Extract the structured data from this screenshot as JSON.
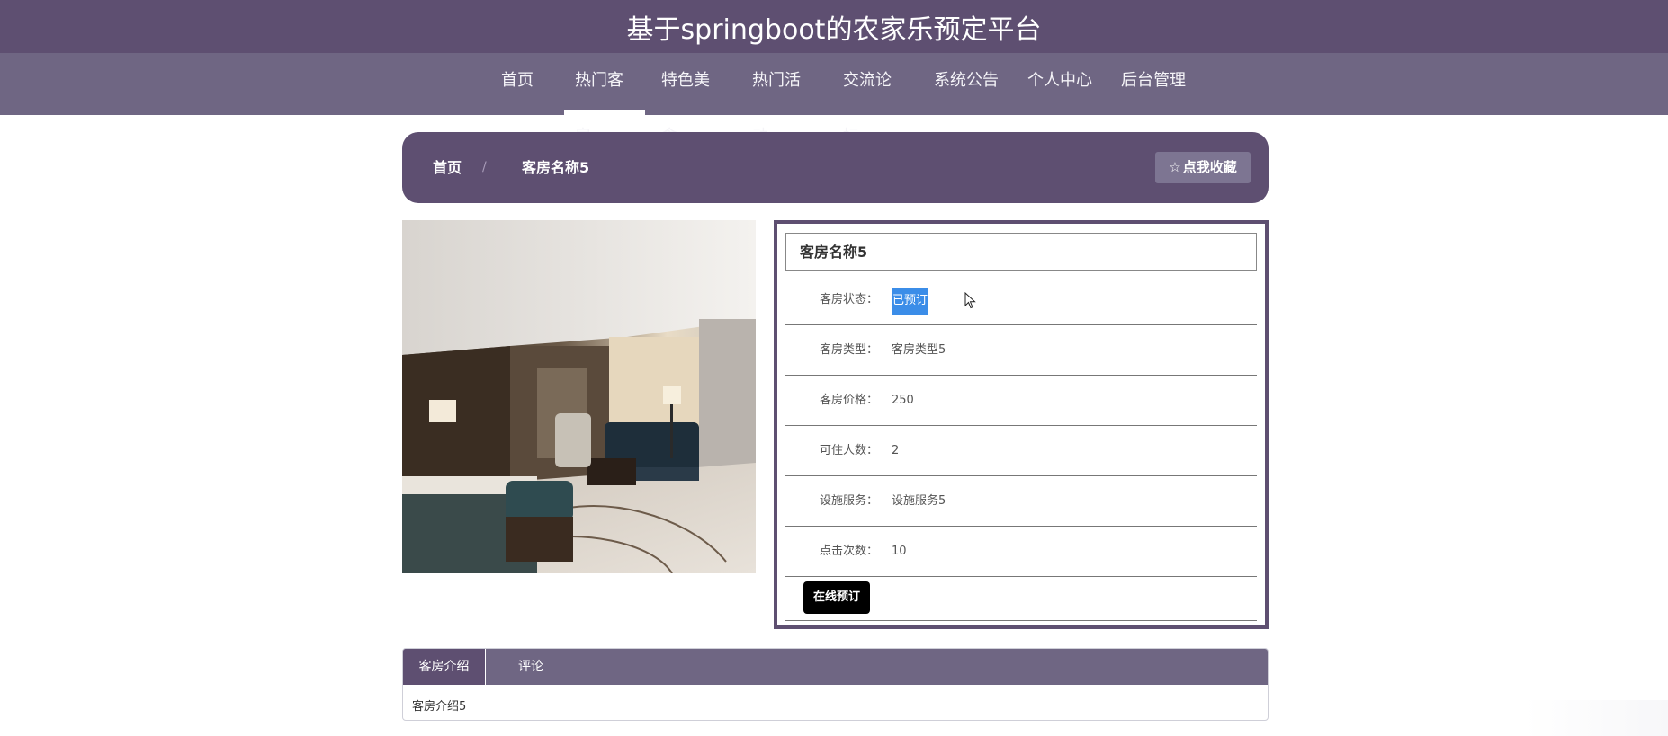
{
  "header": {
    "title": "基于springboot的农家乐预定平台"
  },
  "nav": {
    "items": [
      {
        "label": "首页"
      },
      {
        "label": "热门客房"
      },
      {
        "label": "特色美食"
      },
      {
        "label": "热门活动"
      },
      {
        "label": "交流论坛"
      },
      {
        "label": "系统公告"
      },
      {
        "label": "个人中心"
      },
      {
        "label": "后台管理"
      }
    ],
    "active": "热门客房"
  },
  "breadcrumb": {
    "home": "首页",
    "separator": "/",
    "current": "客房名称5"
  },
  "favorite_button": {
    "icon": "star-outline-icon",
    "label": "点我收藏"
  },
  "room_image": {
    "description_icon": "room-photo"
  },
  "detail": {
    "title": "客房名称5",
    "fields": [
      {
        "label": "客房状态：",
        "value": "已预订"
      },
      {
        "label": "客房类型：",
        "value": "客房类型5"
      },
      {
        "label": "客房价格：",
        "value": "250"
      },
      {
        "label": "可住人数：",
        "value": "2"
      },
      {
        "label": "设施服务：",
        "value": "设施服务5"
      },
      {
        "label": "点击次数：",
        "value": "10"
      }
    ],
    "book_button": "在线预订"
  },
  "tabs": {
    "items": [
      {
        "label": "客房介绍"
      },
      {
        "label": "评论"
      }
    ],
    "active": "客房介绍",
    "content": "客房介绍5"
  },
  "colors": {
    "primary": "#5e4f71",
    "nav": "#6f6683",
    "highlight": "#3b8de8"
  }
}
